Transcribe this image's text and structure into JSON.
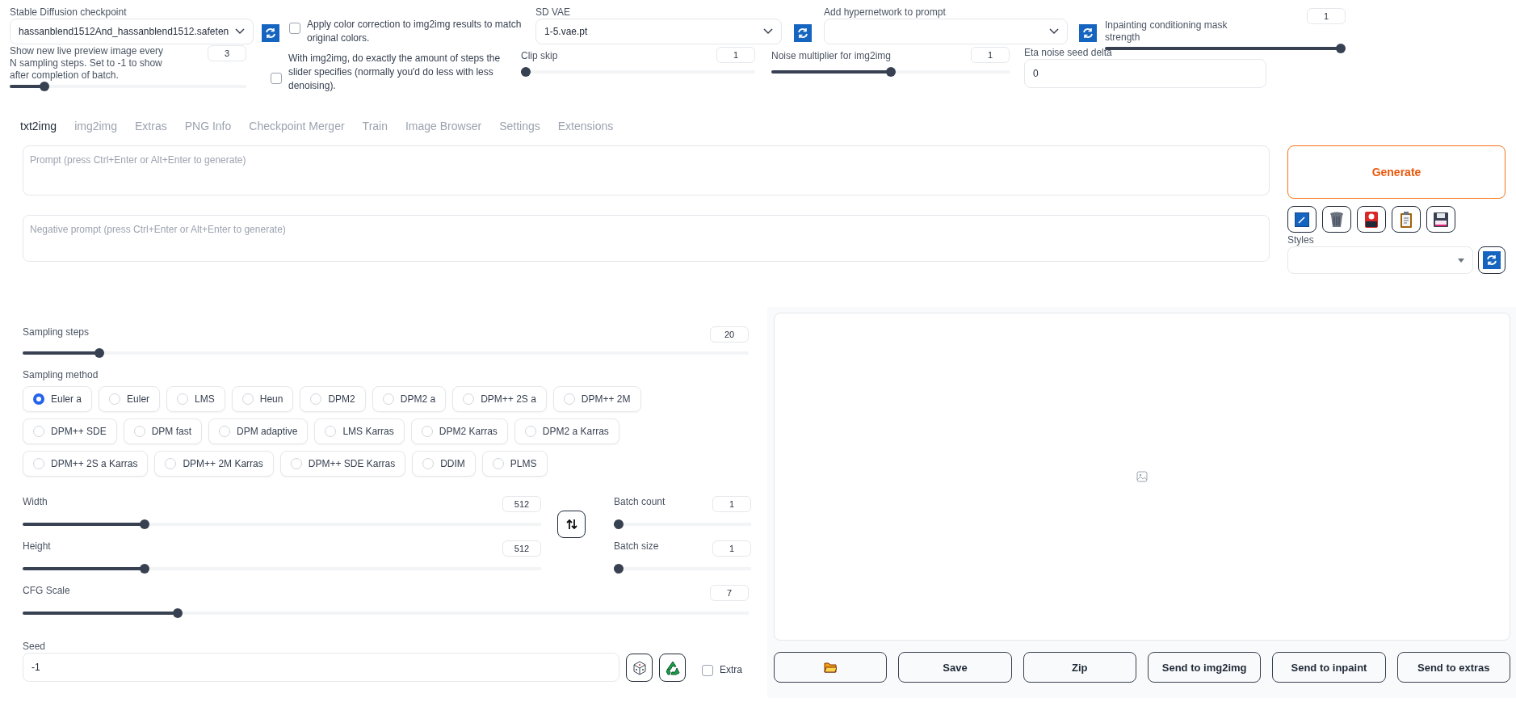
{
  "settings": {
    "checkpoint": {
      "label": "Stable Diffusion checkpoint",
      "value": "hassanblend1512And_hassanblend1512.safeten"
    },
    "color_correction": {
      "label": "Apply color correction to img2img results to match original colors.",
      "checked": false
    },
    "vae": {
      "label": "SD VAE",
      "value": "1-5.vae.pt"
    },
    "hypernetwork": {
      "label": "Add hypernetwork to prompt"
    },
    "inpainting_mask_strength": {
      "label": "Inpainting conditioning mask strength",
      "value": "1",
      "level": 1
    },
    "live_preview": {
      "label": "Show new live preview image every N sampling steps. Set to -1 to show after completion of batch.",
      "value": "3",
      "level": 0.13
    },
    "img2img_exact_steps": {
      "label": "With img2img, do exactly the amount of steps the slider specifies (normally you'd do less with less denoising).",
      "checked": false
    },
    "clip_skip": {
      "label": "Clip skip",
      "value": "1",
      "level": 0
    },
    "noise_multiplier": {
      "label": "Noise multiplier for img2img",
      "value": "1",
      "level": 0.5
    },
    "eta_noise_seed_delta": {
      "label": "Eta noise seed delta",
      "value": "0"
    }
  },
  "tabs": [
    {
      "label": "txt2img",
      "selected": true
    },
    {
      "label": "img2img",
      "selected": false
    },
    {
      "label": "Extras",
      "selected": false
    },
    {
      "label": "PNG Info",
      "selected": false
    },
    {
      "label": "Checkpoint Merger",
      "selected": false
    },
    {
      "label": "Train",
      "selected": false
    },
    {
      "label": "Image Browser",
      "selected": false
    },
    {
      "label": "Settings",
      "selected": false
    },
    {
      "label": "Extensions",
      "selected": false
    }
  ],
  "prompt": {
    "placeholder": "Prompt (press Ctrl+Enter or Alt+Enter to generate)"
  },
  "negative_prompt": {
    "placeholder": "Negative prompt (press Ctrl+Enter or Alt+Enter to generate)"
  },
  "generate": {
    "label": "Generate"
  },
  "styles": {
    "label": "Styles"
  },
  "sampling_steps": {
    "label": "Sampling steps",
    "value": "20",
    "level": 0.1
  },
  "sampling_method": {
    "label": "Sampling method",
    "options": [
      {
        "label": "Euler a",
        "selected": true
      },
      {
        "label": "Euler",
        "selected": false
      },
      {
        "label": "LMS",
        "selected": false
      },
      {
        "label": "Heun",
        "selected": false
      },
      {
        "label": "DPM2",
        "selected": false
      },
      {
        "label": "DPM2 a",
        "selected": false
      },
      {
        "label": "DPM++ 2S a",
        "selected": false
      },
      {
        "label": "DPM++ 2M",
        "selected": false
      },
      {
        "label": "DPM++ SDE",
        "selected": false
      },
      {
        "label": "DPM fast",
        "selected": false
      },
      {
        "label": "DPM adaptive",
        "selected": false
      },
      {
        "label": "LMS Karras",
        "selected": false
      },
      {
        "label": "DPM2 Karras",
        "selected": false
      },
      {
        "label": "DPM2 a Karras",
        "selected": false
      },
      {
        "label": "DPM++ 2S a Karras",
        "selected": false
      },
      {
        "label": "DPM++ 2M Karras",
        "selected": false
      },
      {
        "label": "DPM++ SDE Karras",
        "selected": false
      },
      {
        "label": "DDIM",
        "selected": false
      },
      {
        "label": "PLMS",
        "selected": false
      }
    ]
  },
  "width": {
    "label": "Width",
    "value": "512",
    "level": 0.23
  },
  "height": {
    "label": "Height",
    "value": "512",
    "level": 0.23
  },
  "batch_count": {
    "label": "Batch count",
    "value": "1",
    "level": 0
  },
  "batch_size": {
    "label": "Batch size",
    "value": "1",
    "level": 0
  },
  "cfg_scale": {
    "label": "CFG Scale",
    "value": "7",
    "level": 0.21
  },
  "seed": {
    "label": "Seed",
    "value": "-1"
  },
  "extra": {
    "label": "Extra",
    "checked": false
  },
  "output_buttons": [
    "Save",
    "Zip",
    "Send to img2img",
    "Send to inpaint",
    "Send to extras"
  ]
}
